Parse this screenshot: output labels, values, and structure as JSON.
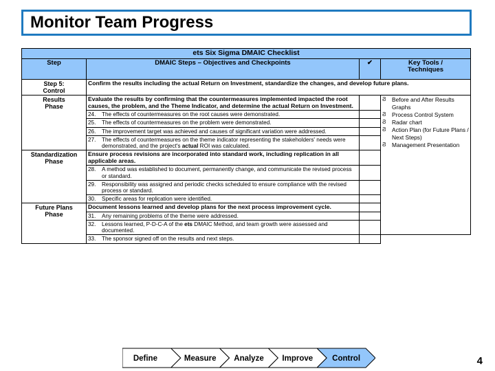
{
  "title": "Monitor Team Progress",
  "page_number": "4",
  "colors": {
    "title_border": "#1f7ac0",
    "table_header_bg": "#93c6fb",
    "chevron_active_fill": "#93c6fb"
  },
  "table": {
    "caption": "ets Six Sigma DMAIC Checklist",
    "columns": {
      "step": "Step",
      "steps_objectives": "DMAIC Steps – Objectives and Checkpoints",
      "check": "✔",
      "key_tools": "Key Tools /\nTechniques",
      "key_tools_line1": "Key Tools /",
      "key_tools_line2": "Techniques"
    },
    "step_header": {
      "step_label_line1": "Step 5:",
      "step_label_line2": "Control",
      "objective": "Confirm the results including the actual Return on Investment, standardize the changes, and develop future plans."
    },
    "phases": [
      {
        "name_line1": "Results",
        "name_line2": "Phase",
        "objective": "Evaluate the results by confirming that the countermeasures implemented impacted the root causes, the problem, and the Theme Indicator, and determine the actual Return on Investment.",
        "items": [
          {
            "num": "24.",
            "text": "The effects of countermeasures on the root causes were demonstrated."
          },
          {
            "num": "25.",
            "text": "The effects of countermeasures on the problem were demonstrated."
          },
          {
            "num": "26.",
            "text": "The improvement target was achieved and causes of significant variation were addressed."
          },
          {
            "num": "27.",
            "text": "The effects of countermeasures on the theme indicator representing the stakeholders' needs were demonstrated, and the project's actual ROI was calculated.",
            "bold_word": "actual"
          }
        ]
      },
      {
        "name_line1": "Standardization",
        "name_line2": "Phase",
        "objective": "Ensure process revisions are incorporated into standard work, including replication in all applicable areas.",
        "items": [
          {
            "num": "28.",
            "text": "A method was established to document, permanently change, and communicate the revised process or standard."
          },
          {
            "num": "29.",
            "text": "Responsibility was assigned and periodic checks scheduled to ensure compliance with the revised process or standard."
          },
          {
            "num": "30.",
            "text": "Specific areas for replication were identified."
          }
        ]
      },
      {
        "name_line1": "Future Plans",
        "name_line2": "Phase",
        "objective": "Document lessons learned and develop plans for the next process improvement cycle.",
        "items": [
          {
            "num": "31.",
            "text": "Any remaining problems of the theme were addressed."
          },
          {
            "num": "32.",
            "text": "Lessons learned, P-D-C-A of the ets DMAIC Method, and team growth were assessed and documented.",
            "bold_word": "ets"
          },
          {
            "num": "33.",
            "text": "The sponsor signed off on the results and next steps."
          }
        ]
      }
    ],
    "key_tools": [
      "Before and After Results Graphs",
      "Process Control System",
      "Radar chart",
      "Action Plan (for Future Plans / Next Steps)",
      "Management Presentation"
    ],
    "bullet_glyph": "ɣǝo"
  },
  "dmaic_strip": {
    "phases": [
      {
        "label": "Define",
        "active": false
      },
      {
        "label": "Measure",
        "active": false
      },
      {
        "label": "Analyze",
        "active": false
      },
      {
        "label": "Improve",
        "active": false
      },
      {
        "label": "Control",
        "active": true
      }
    ]
  }
}
